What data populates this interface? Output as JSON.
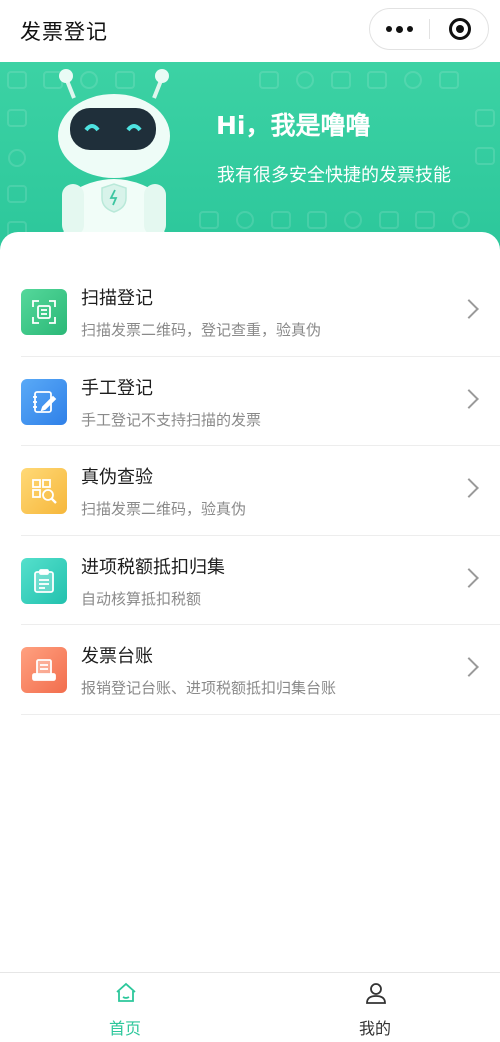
{
  "header": {
    "title": "发票登记"
  },
  "banner": {
    "greeting": "Hi，我是噜噜",
    "subtitle": "我有很多安全快捷的发票技能"
  },
  "menu": [
    {
      "title": "扫描登记",
      "desc": "扫描发票二维码，登记查重，验真伪",
      "icon": "scan-qr-icon",
      "color": "#2bb877"
    },
    {
      "title": "手工登记",
      "desc": "手工登记不支持扫描的发票",
      "icon": "notebook-pen-icon",
      "color": "#2f80e8"
    },
    {
      "title": "真伪查验",
      "desc": "扫描发票二维码，验真伪",
      "icon": "qr-magnifier-icon",
      "color": "#f6b73b"
    },
    {
      "title": "进项税额抵扣归集",
      "desc": "自动核算抵扣税额",
      "icon": "clipboard-icon",
      "color": "#22c1ae"
    },
    {
      "title": "发票台账",
      "desc": "报销登记台账、进项税额抵扣归集台账",
      "icon": "ledger-icon",
      "color": "#f26d4d"
    }
  ],
  "tabbar": {
    "home_label": "首页",
    "mine_label": "我的",
    "active_color": "#2cc79b"
  }
}
